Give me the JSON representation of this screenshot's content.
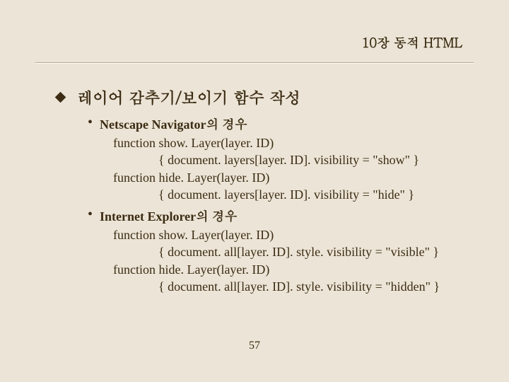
{
  "header": "10장 동적 HTML",
  "title": "레이어 감추기/보이기 함수 작성",
  "sections": [
    {
      "bullet": "Netscape Navigator의 경우",
      "lines": [
        {
          "text": "function show. Layer(layer. ID)",
          "indent": false
        },
        {
          "text": "{ document. layers[layer. ID]. visibility = \"show\" }",
          "indent": true
        },
        {
          "text": "function hide. Layer(layer. ID)",
          "indent": false
        },
        {
          "text": "{ document. layers[layer. ID]. visibility = \"hide\" }",
          "indent": true
        }
      ]
    },
    {
      "bullet": "Internet Explorer의 경우",
      "lines": [
        {
          "text": "function show. Layer(layer. ID)",
          "indent": false
        },
        {
          "text": "{ document. all[layer. ID]. style. visibility = \"visible\" }",
          "indent": true
        },
        {
          "text": "function hide. Layer(layer. ID)",
          "indent": false
        },
        {
          "text": "{ document. all[layer. ID]. style. visibility = \"hidden\" }",
          "indent": true
        }
      ]
    }
  ],
  "page_number": "57"
}
